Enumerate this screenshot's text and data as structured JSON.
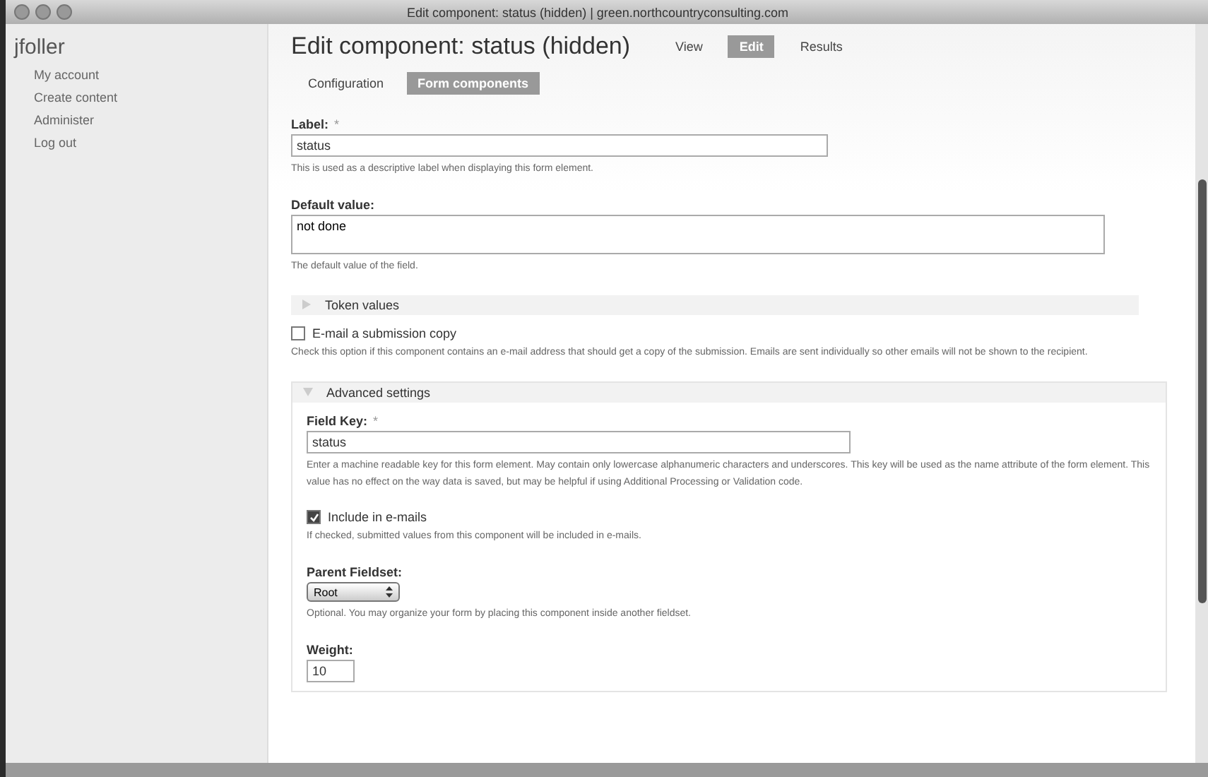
{
  "window": {
    "title": "Edit component: status (hidden) | green.northcountryconsulting.com"
  },
  "sidebar": {
    "user": "jfoller",
    "items": [
      {
        "label": "My account"
      },
      {
        "label": "Create content"
      },
      {
        "label": "Administer"
      },
      {
        "label": "Log out"
      }
    ]
  },
  "page": {
    "title": "Edit component: status (hidden)",
    "tabs": [
      {
        "label": "View",
        "selected": false
      },
      {
        "label": "Edit",
        "selected": true
      },
      {
        "label": "Results",
        "selected": false
      }
    ],
    "subtabs": [
      {
        "label": "Configuration",
        "selected": false
      },
      {
        "label": "Form components",
        "selected": true
      }
    ]
  },
  "form": {
    "label": {
      "label": "Label:",
      "required": "*",
      "value": "status",
      "description": "This is used as a descriptive label when displaying this form element."
    },
    "default_value": {
      "label": "Default value:",
      "value": "not done",
      "description": "The default value of the field."
    },
    "token_values": {
      "label": "Token values",
      "expanded": false
    },
    "email_copy": {
      "label": "E-mail a submission copy",
      "checked": false,
      "description": "Check this option if this component contains an e-mail address that should get a copy of the submission. Emails are sent individually so other emails will not be shown to the recipient."
    },
    "advanced": {
      "label": "Advanced settings",
      "expanded": true,
      "field_key": {
        "label": "Field Key:",
        "required": "*",
        "value": "status",
        "description": "Enter a machine readable key for this form element. May contain only lowercase alphanumeric characters and underscores. This key will be used as the name attribute of the form element. This value has no effect on the way data is saved, but may be helpful if using Additional Processing or Validation code."
      },
      "include_emails": {
        "label": "Include in e-mails",
        "checked": true,
        "description": "If checked, submitted values from this component will be included in e-mails."
      },
      "parent_fieldset": {
        "label": "Parent Fieldset:",
        "value": "Root",
        "description": "Optional. You may organize your form by placing this component inside another fieldset."
      },
      "weight": {
        "label": "Weight:",
        "value": "10"
      }
    }
  }
}
